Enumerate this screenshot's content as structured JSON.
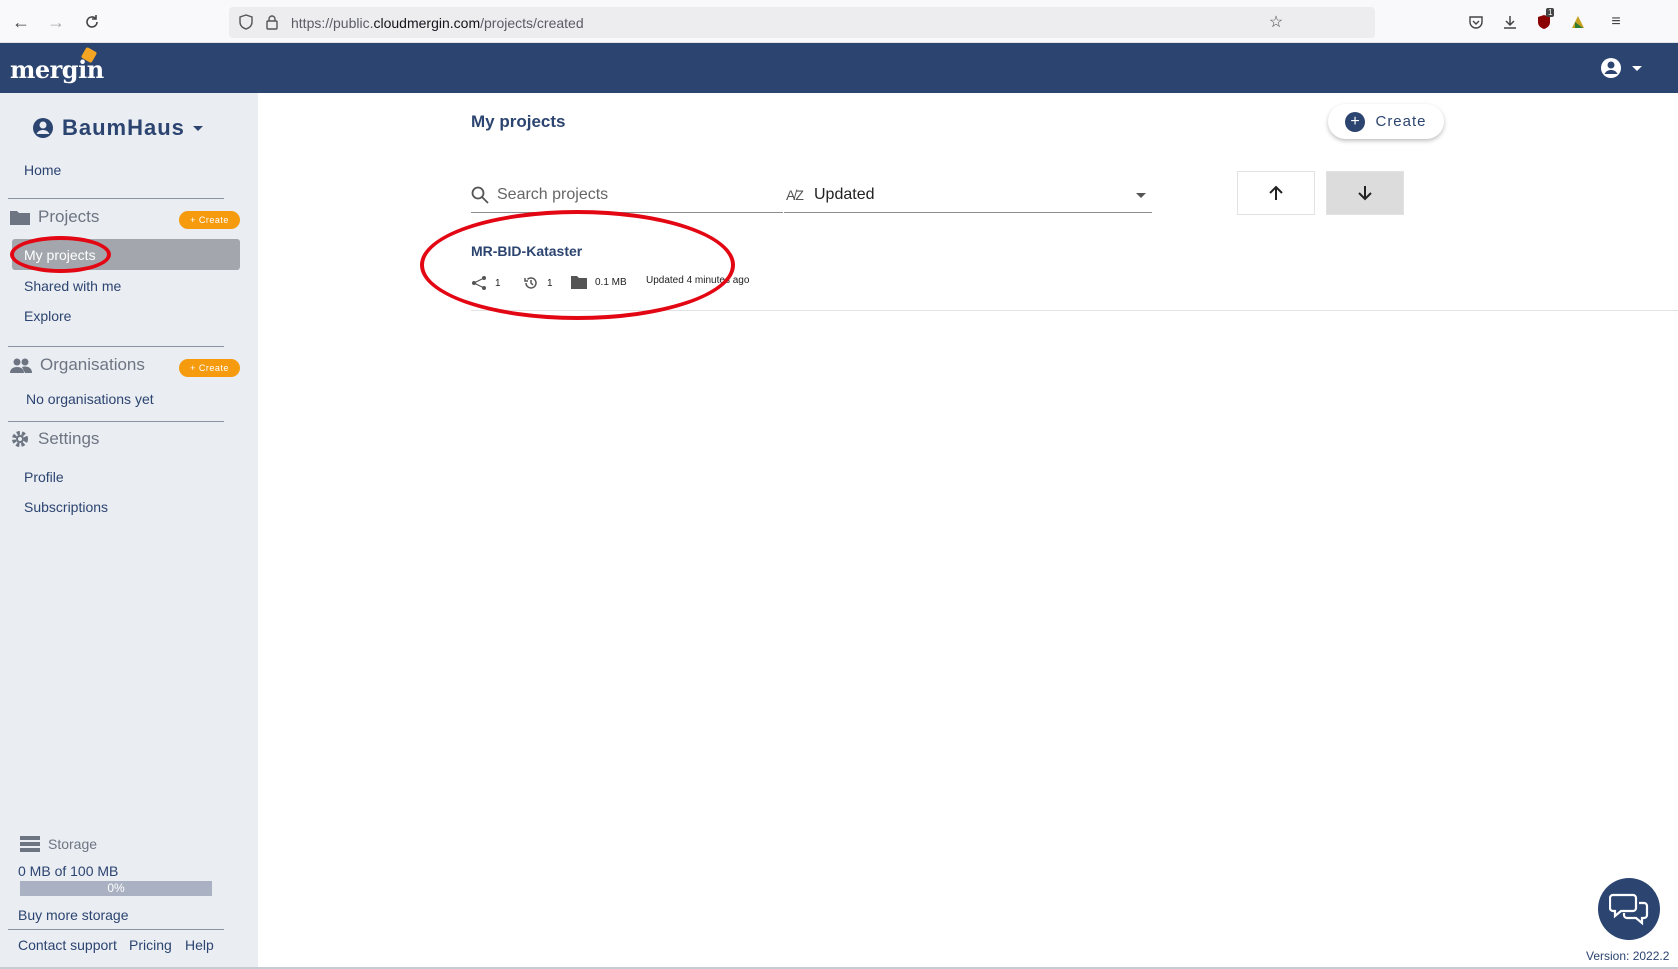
{
  "browser": {
    "url_prefix": "https://public.",
    "url_domain": "cloudmergin.com",
    "url_path": "/projects/created",
    "extension_badge": "1"
  },
  "header": {
    "logo_text": "mergin",
    "brand_color": "#2c4470",
    "accent_color": "#f59b0d"
  },
  "sidebar": {
    "workspace_name": "BaumHaus",
    "home_label": "Home",
    "projects_section": "Projects",
    "projects_create": "+ Create",
    "my_projects": "My projects",
    "shared_with_me": "Shared with me",
    "explore": "Explore",
    "organisations_section": "Organisations",
    "organisations_create": "+ Create",
    "no_organisations": "No organisations yet",
    "settings_section": "Settings",
    "profile": "Profile",
    "subscriptions": "Subscriptions",
    "storage_label": "Storage",
    "storage_used": "0 MB of 100 MB",
    "storage_percent": "0%",
    "buy_storage": "Buy more storage",
    "contact_support": "Contact support",
    "pricing": "Pricing",
    "help": "Help"
  },
  "main": {
    "title": "My projects",
    "create_button": "Create",
    "search_placeholder": "Search projects",
    "sort_value": "Updated",
    "projects": [
      {
        "name": "MR-BID-Kataster",
        "shared_count": "1",
        "versions": "1",
        "size": "0.1 MB",
        "updated": "Updated 4 minutes ago"
      }
    ]
  },
  "footer": {
    "version": "Version: 2022.2"
  },
  "annotation_color": "#e30613"
}
